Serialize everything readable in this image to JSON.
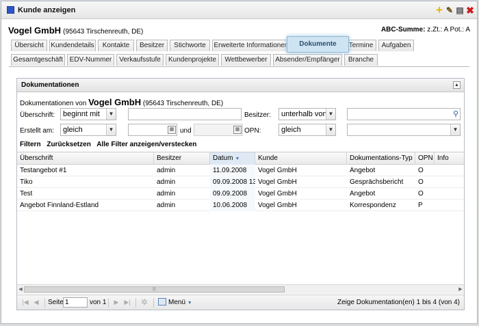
{
  "window": {
    "title": "Kunde anzeigen"
  },
  "customer": {
    "name": "Vogel GmbH",
    "address": "(95643 Tirschenreuth, DE)"
  },
  "abc": {
    "label": "ABC-Summe:",
    "value": "z.Zt.: A Pot.: A"
  },
  "tabs_row1": [
    "Übersicht",
    "Kundendetails",
    "Kontakte",
    "Besitzer",
    "Stichworte",
    "Erweiterte Informationen",
    "Dokumente",
    "Termine",
    "Aufgaben"
  ],
  "tabs_row2": [
    "Gesamtgeschäft",
    "EDV-Nummer",
    "Verkaufsstufe",
    "Kundenprojekte",
    "Wettbewerber",
    "Absender/Empfänger",
    "Branche"
  ],
  "active_tab": "Dokumente",
  "panel": {
    "title": "Dokumentationen",
    "intro_prefix": "Dokumentationen von",
    "intro_name": "Vogel GmbH",
    "intro_address": "(95643 Tirschenreuth, DE)"
  },
  "filters": {
    "ueberschrift_label": "Überschrift:",
    "ueberschrift_op": "beginnt mit",
    "ueberschrift_value": "",
    "besitzer_label": "Besitzer:",
    "besitzer_op": "unterhalb von",
    "besitzer_value": "",
    "erstellt_label": "Erstellt am:",
    "erstellt_op": "gleich",
    "date_from": "",
    "und_label": "und",
    "date_to": "",
    "opn_label": "OPN:",
    "opn_op": "gleich",
    "opn_value": ""
  },
  "filter_links": {
    "filter": "Filtern",
    "reset": "Zurücksetzen",
    "toggle": "Alle Filter anzeigen/verstecken"
  },
  "grid": {
    "columns": [
      "Überschrift",
      "Besitzer",
      "Datum",
      "Kunde",
      "Dokumentations-Typ",
      "OPN",
      "Info"
    ],
    "sorted_column": "Datum",
    "rows": [
      [
        "Testangebot #1",
        "admin",
        "11.09.2008",
        "Vogel GmbH",
        "Angebot",
        "O",
        ""
      ],
      [
        "Tiko",
        "admin",
        "09.09.2008 13:",
        "Vogel GmbH",
        "Gesprächsbericht",
        "O",
        ""
      ],
      [
        "Test",
        "admin",
        "09.09.2008",
        "Vogel GmbH",
        "Angebot",
        "O",
        ""
      ],
      [
        "Angebot Finnland-Estland",
        "admin",
        "10.06.2008",
        "Vogel GmbH",
        "Korrespondenz",
        "P",
        ""
      ]
    ]
  },
  "pager": {
    "page_label": "Seite",
    "page_value": "1",
    "of_label": "von 1",
    "menu_label": "Menü",
    "info": "Zeige Dokumentation(en) 1 bis 4 (von 4)"
  },
  "icons": {
    "add": "plus-icon",
    "edit": "pencil-icon",
    "save": "save-icon",
    "close": "close-icon",
    "sort": "sort-descending-icon",
    "calendar": "calendar-icon",
    "search": "search-icon"
  },
  "colors": {
    "accent": "#2f55c8",
    "active_tab_bg": "#cfe4f2",
    "close": "#cc1b1b",
    "add": "#e8b400"
  }
}
